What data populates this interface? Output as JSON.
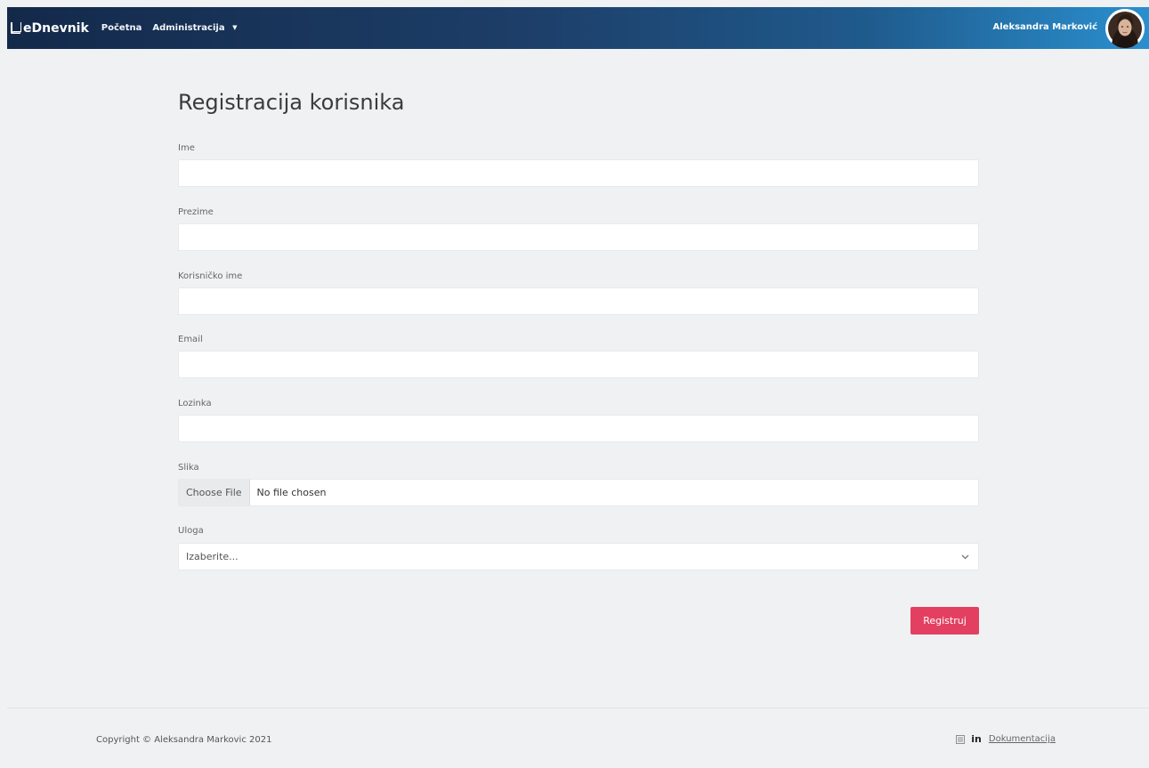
{
  "navbar": {
    "brand": "eDnevnik",
    "links": [
      {
        "label": "Početna"
      },
      {
        "label": "Administracija",
        "caret": "▼"
      }
    ],
    "user_name": "Aleksandra Marković"
  },
  "form": {
    "title": "Registracija korisnika",
    "fields": {
      "ime": {
        "label": "Ime",
        "value": ""
      },
      "prezime": {
        "label": "Prezime",
        "value": ""
      },
      "korisnicko_ime": {
        "label": "Korisničko ime",
        "value": ""
      },
      "email": {
        "label": "Email",
        "value": ""
      },
      "lozinka": {
        "label": "Lozinka",
        "value": ""
      },
      "slika": {
        "label": "Slika",
        "button": "Choose File",
        "status": "No file chosen"
      },
      "uloga": {
        "label": "Uloga",
        "selected": "Izaberite..."
      }
    },
    "submit_label": "Registruj"
  },
  "footer": {
    "copyright": "Copyright © Aleksandra Markovic 2021",
    "linkedin": "in",
    "doc_link": "Dokumentacija"
  },
  "colors": {
    "navbar_start": "#13294a",
    "navbar_end": "#2a8fce",
    "accent_button": "#e34061",
    "page_background": "#f0f1f3"
  },
  "icons": {
    "brand": "book-icon",
    "dropdown": "caret-down-icon",
    "select": "chevron-down-icon",
    "footer_left": "external-link-icon",
    "footer_linkedin": "linkedin-icon"
  }
}
